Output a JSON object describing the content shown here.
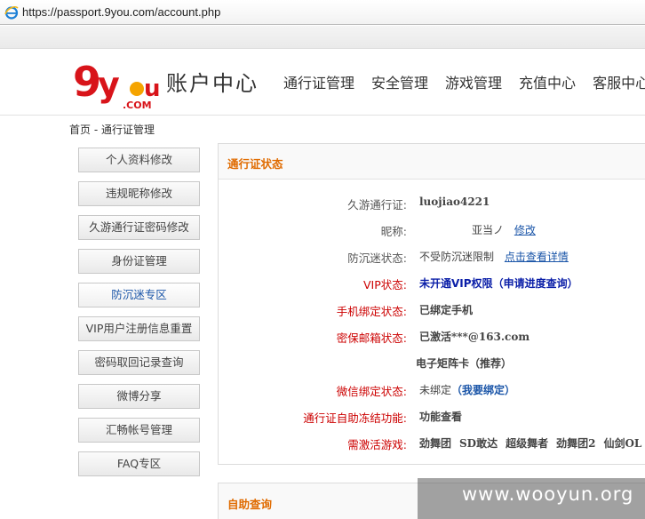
{
  "browser": {
    "url": "https://passport.9you.com/account.php"
  },
  "header": {
    "logo_text": "9you.com",
    "title": "账户中心",
    "nav": [
      "通行证管理",
      "安全管理",
      "游戏管理",
      "充值中心",
      "客服中心"
    ]
  },
  "breadcrumb": "首页 - 通行证管理",
  "sidebar": {
    "items": [
      "个人资料修改",
      "违规昵称修改",
      "久游通行证密码修改",
      "身份证管理",
      "防沉迷专区",
      "VIP用户注册信息重置",
      "密码取回记录查询",
      "微博分享",
      "汇畅帐号管理",
      "FAQ专区"
    ]
  },
  "status_panel": {
    "title": "通行证状态",
    "rows": {
      "passport": {
        "label": "久游通行证:",
        "value": "luojiao4221"
      },
      "nickname": {
        "label": "昵称:",
        "value": "亚当ノ",
        "link": "修改"
      },
      "anti_addiction": {
        "label": "防沉迷状态:",
        "value": "不受防沉迷限制",
        "link": "点击查看详情"
      },
      "vip": {
        "label": "VIP状态:",
        "value": "未开通VIP权限",
        "link": "（申请进度查询）"
      },
      "phone": {
        "label": "手机绑定状态:",
        "value": "已绑定手机"
      },
      "email": {
        "label": "密保邮箱状态:",
        "value": "已激活***@163.com"
      },
      "matrix": {
        "value": "电子矩阵卡（推荐）"
      },
      "wechat": {
        "label": "微信绑定状态:",
        "value": "未绑定",
        "link": "（我要绑定）"
      },
      "freeze": {
        "label": "通行证自助冻结功能:",
        "value": "功能查看"
      },
      "games": {
        "label": "需激活游戏:",
        "values": [
          "劲舞团",
          "SD敢达",
          "超级舞者",
          "劲舞团2",
          "仙剑OL"
        ]
      }
    }
  },
  "query_panel": {
    "title": "自助查询"
  },
  "watermark": "www.wooyun.org"
}
